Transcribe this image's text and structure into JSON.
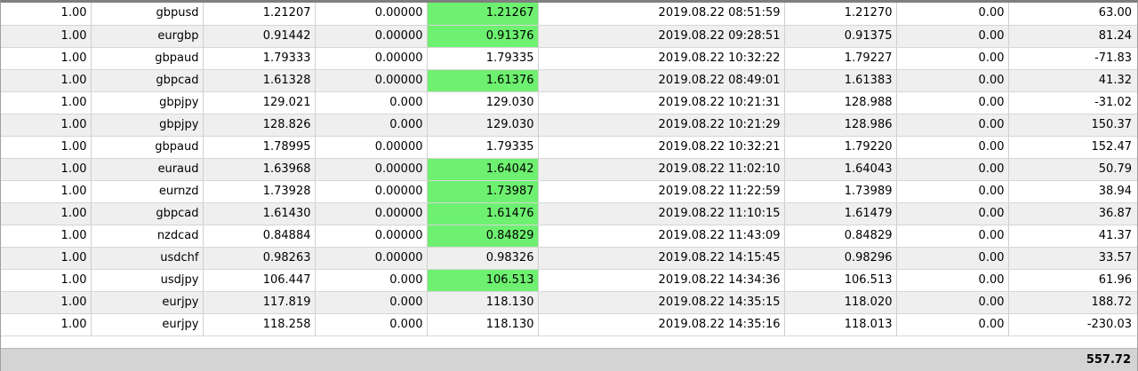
{
  "colors": {
    "highlight": "#6ef070",
    "row_alt": "#efefef",
    "footer": "#d4d4d4"
  },
  "rows": [
    {
      "volume": "1.00",
      "symbol": "gbpusd",
      "open_price": "1.21207",
      "sl": "0.00000",
      "tp": "1.21267",
      "tp_hit": true,
      "close_time": "2019.08.22 08:51:59",
      "close_price": "1.21270",
      "swap": "0.00",
      "profit": "63.00"
    },
    {
      "volume": "1.00",
      "symbol": "eurgbp",
      "open_price": "0.91442",
      "sl": "0.00000",
      "tp": "0.91376",
      "tp_hit": true,
      "close_time": "2019.08.22 09:28:51",
      "close_price": "0.91375",
      "swap": "0.00",
      "profit": "81.24"
    },
    {
      "volume": "1.00",
      "symbol": "gbpaud",
      "open_price": "1.79333",
      "sl": "0.00000",
      "tp": "1.79335",
      "tp_hit": false,
      "close_time": "2019.08.22 10:32:22",
      "close_price": "1.79227",
      "swap": "0.00",
      "profit": "-71.83"
    },
    {
      "volume": "1.00",
      "symbol": "gbpcad",
      "open_price": "1.61328",
      "sl": "0.00000",
      "tp": "1.61376",
      "tp_hit": true,
      "close_time": "2019.08.22 08:49:01",
      "close_price": "1.61383",
      "swap": "0.00",
      "profit": "41.32"
    },
    {
      "volume": "1.00",
      "symbol": "gbpjpy",
      "open_price": "129.021",
      "sl": "0.000",
      "tp": "129.030",
      "tp_hit": false,
      "close_time": "2019.08.22 10:21:31",
      "close_price": "128.988",
      "swap": "0.00",
      "profit": "-31.02"
    },
    {
      "volume": "1.00",
      "symbol": "gbpjpy",
      "open_price": "128.826",
      "sl": "0.000",
      "tp": "129.030",
      "tp_hit": false,
      "close_time": "2019.08.22 10:21:29",
      "close_price": "128.986",
      "swap": "0.00",
      "profit": "150.37"
    },
    {
      "volume": "1.00",
      "symbol": "gbpaud",
      "open_price": "1.78995",
      "sl": "0.00000",
      "tp": "1.79335",
      "tp_hit": false,
      "close_time": "2019.08.22 10:32:21",
      "close_price": "1.79220",
      "swap": "0.00",
      "profit": "152.47"
    },
    {
      "volume": "1.00",
      "symbol": "euraud",
      "open_price": "1.63968",
      "sl": "0.00000",
      "tp": "1.64042",
      "tp_hit": true,
      "close_time": "2019.08.22 11:02:10",
      "close_price": "1.64043",
      "swap": "0.00",
      "profit": "50.79"
    },
    {
      "volume": "1.00",
      "symbol": "eurnzd",
      "open_price": "1.73928",
      "sl": "0.00000",
      "tp": "1.73987",
      "tp_hit": true,
      "close_time": "2019.08.22 11:22:59",
      "close_price": "1.73989",
      "swap": "0.00",
      "profit": "38.94"
    },
    {
      "volume": "1.00",
      "symbol": "gbpcad",
      "open_price": "1.61430",
      "sl": "0.00000",
      "tp": "1.61476",
      "tp_hit": true,
      "close_time": "2019.08.22 11:10:15",
      "close_price": "1.61479",
      "swap": "0.00",
      "profit": "36.87"
    },
    {
      "volume": "1.00",
      "symbol": "nzdcad",
      "open_price": "0.84884",
      "sl": "0.00000",
      "tp": "0.84829",
      "tp_hit": true,
      "close_time": "2019.08.22 11:43:09",
      "close_price": "0.84829",
      "swap": "0.00",
      "profit": "41.37"
    },
    {
      "volume": "1.00",
      "symbol": "usdchf",
      "open_price": "0.98263",
      "sl": "0.00000",
      "tp": "0.98326",
      "tp_hit": false,
      "close_time": "2019.08.22 14:15:45",
      "close_price": "0.98296",
      "swap": "0.00",
      "profit": "33.57"
    },
    {
      "volume": "1.00",
      "symbol": "usdjpy",
      "open_price": "106.447",
      "sl": "0.000",
      "tp": "106.513",
      "tp_hit": true,
      "close_time": "2019.08.22 14:34:36",
      "close_price": "106.513",
      "swap": "0.00",
      "profit": "61.96"
    },
    {
      "volume": "1.00",
      "symbol": "eurjpy",
      "open_price": "117.819",
      "sl": "0.000",
      "tp": "118.130",
      "tp_hit": false,
      "close_time": "2019.08.22 14:35:15",
      "close_price": "118.020",
      "swap": "0.00",
      "profit": "188.72"
    },
    {
      "volume": "1.00",
      "symbol": "eurjpy",
      "open_price": "118.258",
      "sl": "0.000",
      "tp": "118.130",
      "tp_hit": false,
      "close_time": "2019.08.22 14:35:16",
      "close_price": "118.013",
      "swap": "0.00",
      "profit": "-230.03"
    }
  ],
  "total": {
    "profit": "557.72"
  }
}
